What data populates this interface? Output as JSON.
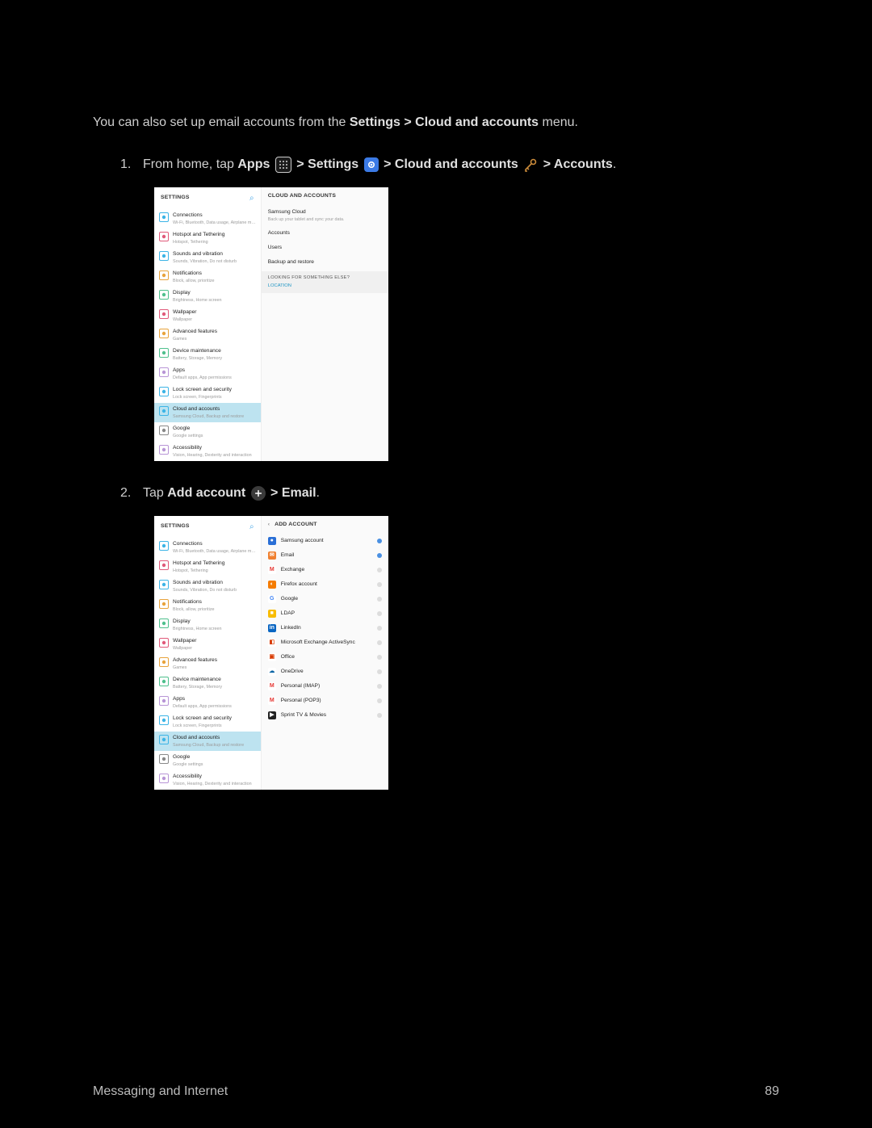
{
  "intro_1": "You can also set up email accounts from the ",
  "intro_2": "Settings > Cloud and accounts",
  "intro_3": " menu.",
  "step1": {
    "num": "1.",
    "a": "From home, tap ",
    "apps": "Apps",
    "b": " > ",
    "settings": "Settings",
    "c": " > ",
    "cloud": "Cloud and accounts",
    "d": " > ",
    "accounts": "Accounts",
    "e": "."
  },
  "step2": {
    "num": "2.",
    "a": "Tap ",
    "add": "Add account",
    "b": " > ",
    "email": "Email",
    "c": "."
  },
  "settings_header": "SETTINGS",
  "settings_items": [
    {
      "title": "Connections",
      "sub": "Wi-Fi, Bluetooth, Data usage, Airplane m…",
      "color": "#3cb4e6"
    },
    {
      "title": "Hotspot and Tethering",
      "sub": "Hotspot, Tethering",
      "color": "#e05a7a"
    },
    {
      "title": "Sounds and vibration",
      "sub": "Sounds, Vibration, Do not disturb",
      "color": "#3cb4e6"
    },
    {
      "title": "Notifications",
      "sub": "Block, allow, prioritize",
      "color": "#e8a33c"
    },
    {
      "title": "Display",
      "sub": "Brightness, Home screen",
      "color": "#4fc08d"
    },
    {
      "title": "Wallpaper",
      "sub": "Wallpaper",
      "color": "#e05a7a"
    },
    {
      "title": "Advanced features",
      "sub": "Games",
      "color": "#e8a33c"
    },
    {
      "title": "Device maintenance",
      "sub": "Battery, Storage, Memory",
      "color": "#4fc08d"
    },
    {
      "title": "Apps",
      "sub": "Default apps, App permissions",
      "color": "#b895d6"
    },
    {
      "title": "Lock screen and security",
      "sub": "Lock screen, Fingerprints",
      "color": "#3cb4e6"
    },
    {
      "title": "Cloud and accounts",
      "sub": "Samsung Cloud, Backup and restore",
      "color": "#3cb4e6",
      "selected": true
    },
    {
      "title": "Google",
      "sub": "Google settings",
      "color": "#888"
    },
    {
      "title": "Accessibility",
      "sub": "Vision, Hearing, Dexterity and interaction",
      "color": "#b895d6"
    }
  ],
  "cloud": {
    "header": "CLOUD AND ACCOUNTS",
    "items": [
      {
        "title": "Samsung Cloud",
        "sub": "Back up your tablet and sync your data."
      },
      {
        "title": "Accounts",
        "sub": ""
      },
      {
        "title": "Users",
        "sub": ""
      },
      {
        "title": "Backup and restore",
        "sub": ""
      }
    ],
    "box_head": "LOOKING FOR SOMETHING ELSE?",
    "box_loc": "LOCATION"
  },
  "add_account": {
    "header": "ADD ACCOUNT",
    "items": [
      {
        "label": "Samsung account",
        "dot": "blue",
        "ico_bg": "#2a6fd6",
        "ico_fg": "#fff",
        "glyph": "●"
      },
      {
        "label": "Email",
        "dot": "blue",
        "ico_bg": "#f08030",
        "ico_fg": "#fff",
        "glyph": "✉"
      },
      {
        "label": "Exchange",
        "dot": "gray",
        "ico_bg": "#fff",
        "ico_fg": "#e53935",
        "glyph": "M"
      },
      {
        "label": "Firefox account",
        "dot": "gray",
        "ico_bg": "#f57c00",
        "ico_fg": "#fff",
        "glyph": "◐"
      },
      {
        "label": "Google",
        "dot": "gray",
        "ico_bg": "#fff",
        "ico_fg": "#4285f4",
        "glyph": "G"
      },
      {
        "label": "LDAP",
        "dot": "gray",
        "ico_bg": "#f8bc00",
        "ico_fg": "#fff",
        "glyph": "■"
      },
      {
        "label": "LinkedIn",
        "dot": "gray",
        "ico_bg": "#0a66c2",
        "ico_fg": "#fff",
        "glyph": "in"
      },
      {
        "label": "Microsoft Exchange ActiveSync",
        "dot": "gray",
        "ico_bg": "#fff",
        "ico_fg": "#d83b01",
        "glyph": "◧"
      },
      {
        "label": "Office",
        "dot": "gray",
        "ico_bg": "#fff",
        "ico_fg": "#d83b01",
        "glyph": "▣"
      },
      {
        "label": "OneDrive",
        "dot": "gray",
        "ico_bg": "#fff",
        "ico_fg": "#0a64a4",
        "glyph": "☁"
      },
      {
        "label": "Personal (IMAP)",
        "dot": "gray",
        "ico_bg": "#fff",
        "ico_fg": "#e53935",
        "glyph": "M"
      },
      {
        "label": "Personal (POP3)",
        "dot": "gray",
        "ico_bg": "#fff",
        "ico_fg": "#e53935",
        "glyph": "M"
      },
      {
        "label": "Sprint TV & Movies",
        "dot": "gray",
        "ico_bg": "#222",
        "ico_fg": "#fff",
        "glyph": "▶"
      }
    ]
  },
  "footer": {
    "left": "Messaging and Internet",
    "right": "89"
  }
}
